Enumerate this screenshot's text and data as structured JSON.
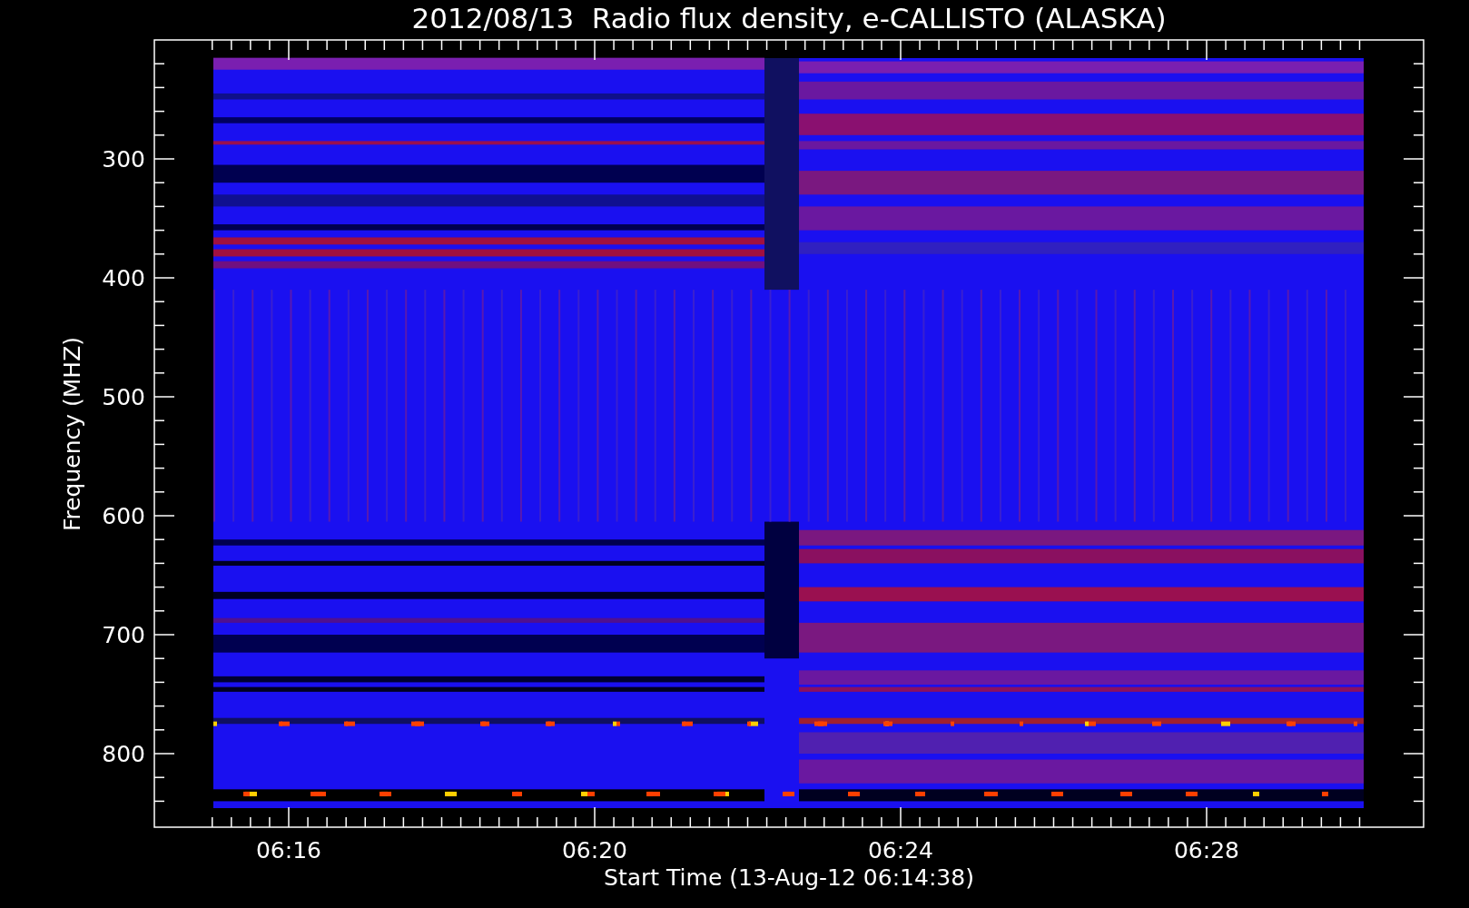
{
  "title": "2012/08/13  Radio flux density, e-CALLISTO (ALASKA)",
  "y_axis": {
    "label": "Frequency (MHZ)",
    "ticks": [
      "300",
      "400",
      "500",
      "600",
      "700",
      "800"
    ]
  },
  "x_axis": {
    "label": "Start Time (13-Aug-12 06:14:38)",
    "ticks": [
      "06:16",
      "06:20",
      "06:24",
      "06:28"
    ]
  }
}
